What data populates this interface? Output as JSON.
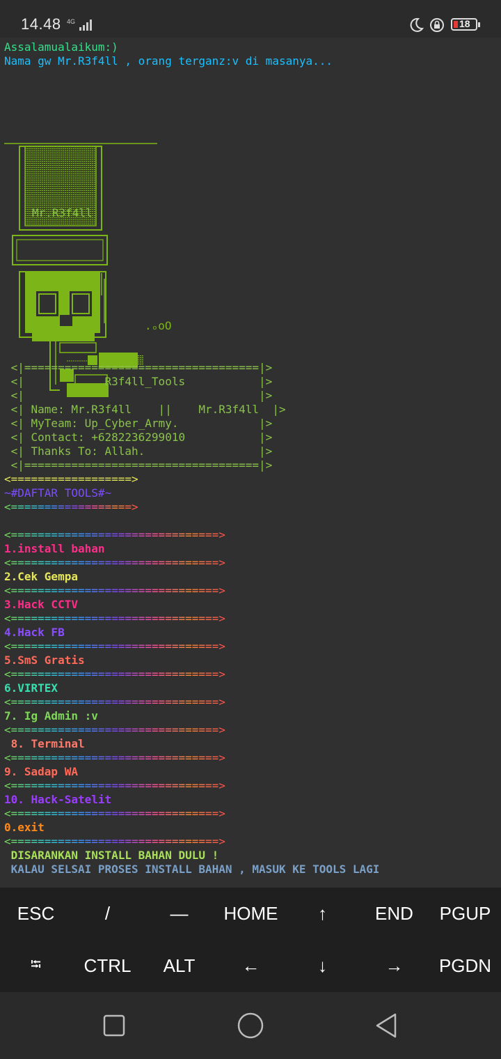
{
  "status": {
    "time": "14.48",
    "network": "4G",
    "battery": "18"
  },
  "terminal": {
    "greeting1": "Assalamualaikum:)",
    "greeting2": "Nama gw Mr.R3f4ll , orang terganz:v di masanya...",
    "art_label": "Mr.R3f4ll",
    "art_bubbles": ".ₒoO",
    "box": {
      "border_top": " <|===================================|>",
      "title_line": " <|            R3f4ll_Tools           |>",
      "empty_line": " <|                                   |>",
      "name_line": " <| Name: Mr.R3f4ll    ||    Mr.R3f4ll  |>",
      "team_line": " <| MyTeam: Up_Cyber_Army.            |>",
      "contact_line": " <| Contact: +6282236299010           |>",
      "thanks_line": " <| Thanks To: Allah.                 |>",
      "border_bottom": " <|===================================|>"
    },
    "menu_arrow_short": "<==================>",
    "menu_header": "~#DAFTAR TOOLS#~",
    "sep": "<===============================>",
    "items": [
      {
        "label": "1.install bahan",
        "color": "#ff2d8a"
      },
      {
        "label": "2.Cek Gempa",
        "color": "#e6e65a"
      },
      {
        "label": "3.Hack CCTV",
        "color": "#ff2d8a"
      },
      {
        "label": "4.Hack FB",
        "color": "#8a4dff"
      },
      {
        "label": "5.SmS Gratis",
        "color": "#ff6a5a"
      },
      {
        "label": "6.VIRTEX",
        "color": "#36e0b0"
      },
      {
        "label": "7. Ig Admin :v",
        "color": "#7ed957"
      },
      {
        "label": " 8. Terminal",
        "color": "#ff7a6a"
      },
      {
        "label": "9. Sadap WA",
        "color": "#ff6a5a"
      },
      {
        "label": "10. Hack-Satelit",
        "color": "#9b3dff"
      },
      {
        "label": "0.exit",
        "color": "#ff8a1a"
      }
    ],
    "notice1": " DISARANKAN INSTALL BAHAN DULU !",
    "notice2": " KALAU SELSAI PROSES INSTALL BAHAN , MASUK KE TOOLS LAGI"
  },
  "extra_keys": {
    "row1": [
      "ESC",
      "/",
      "—",
      "HOME",
      "↑",
      "END",
      "PGUP"
    ],
    "row2": [
      "⭾",
      "CTRL",
      "ALT",
      "←",
      "↓",
      "→",
      "PGDN"
    ]
  },
  "colors": {
    "terminal_bg": "#303030",
    "art_green": "#7cb518",
    "box_green": "#8bc34a",
    "greeting_green": "#33e08a",
    "greeting_cyan": "#19c0ff"
  }
}
